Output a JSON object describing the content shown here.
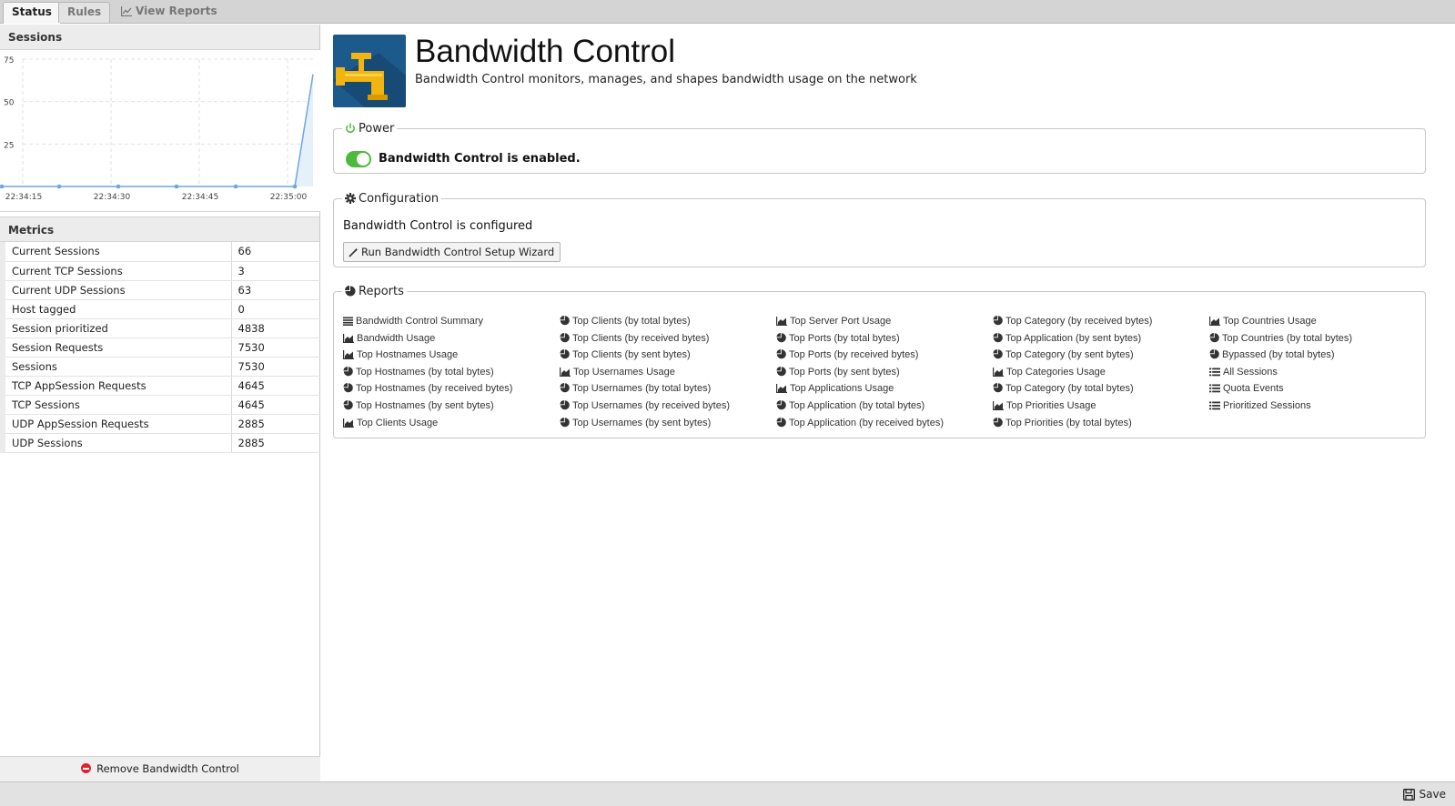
{
  "tabs": {
    "status": "Status",
    "rules": "Rules",
    "view_reports": "View Reports"
  },
  "sessions_panel": {
    "title": "Sessions"
  },
  "chart_data": {
    "type": "line",
    "title": "",
    "y_ticks": [
      "75",
      "50",
      "25"
    ],
    "x_ticks": [
      "22:34:15",
      "22:34:30",
      "22:34:45",
      "22:35:00"
    ],
    "ylim": [
      0,
      75
    ],
    "grid": true,
    "series": [
      {
        "values": [
          0,
          0,
          0,
          0,
          0,
          0,
          66
        ],
        "color": "#6ea6e0"
      }
    ]
  },
  "metrics_panel": {
    "title": "Metrics",
    "rows": [
      {
        "name": "Current Sessions",
        "value": "66"
      },
      {
        "name": "Current TCP Sessions",
        "value": "3"
      },
      {
        "name": "Current UDP Sessions",
        "value": "63"
      },
      {
        "name": "Host tagged",
        "value": "0"
      },
      {
        "name": "Session prioritized",
        "value": "4838"
      },
      {
        "name": "Session Requests",
        "value": "7530"
      },
      {
        "name": "Sessions",
        "value": "7530"
      },
      {
        "name": "TCP AppSession Requests",
        "value": "4645"
      },
      {
        "name": "TCP Sessions",
        "value": "4645"
      },
      {
        "name": "UDP AppSession Requests",
        "value": "2885"
      },
      {
        "name": "UDP Sessions",
        "value": "2885"
      }
    ],
    "remove_label": "Remove Bandwidth Control"
  },
  "app": {
    "title": "Bandwidth Control",
    "description": "Bandwidth Control monitors, manages, and shapes bandwidth usage on the network",
    "icon": "faucet-icon"
  },
  "power": {
    "legend": "Power",
    "status_text": "Bandwidth Control is enabled.",
    "enabled": true,
    "accent": "#4cbb3c"
  },
  "configuration": {
    "legend": "Configuration",
    "status_text": "Bandwidth Control is configured",
    "wizard_button": "Run Bandwidth Control Setup Wizard"
  },
  "reports": {
    "legend": "Reports",
    "columns": [
      [
        {
          "icon": "list",
          "label": "Bandwidth Control Summary"
        },
        {
          "icon": "area",
          "label": "Bandwidth Usage"
        },
        {
          "icon": "area",
          "label": "Top Hostnames Usage"
        },
        {
          "icon": "pie",
          "label": "Top Hostnames (by total bytes)"
        },
        {
          "icon": "pie",
          "label": "Top Hostnames (by received bytes)"
        },
        {
          "icon": "pie",
          "label": "Top Hostnames (by sent bytes)"
        },
        {
          "icon": "area",
          "label": "Top Clients Usage"
        }
      ],
      [
        {
          "icon": "pie",
          "label": "Top Clients (by total bytes)"
        },
        {
          "icon": "pie",
          "label": "Top Clients (by received bytes)"
        },
        {
          "icon": "pie",
          "label": "Top Clients (by sent bytes)"
        },
        {
          "icon": "area",
          "label": "Top Usernames Usage"
        },
        {
          "icon": "pie",
          "label": "Top Usernames (by total bytes)"
        },
        {
          "icon": "pie",
          "label": "Top Usernames (by received bytes)"
        },
        {
          "icon": "pie",
          "label": "Top Usernames (by sent bytes)"
        }
      ],
      [
        {
          "icon": "area",
          "label": "Top Server Port Usage"
        },
        {
          "icon": "pie",
          "label": "Top Ports (by total bytes)"
        },
        {
          "icon": "pie",
          "label": "Top Ports (by received bytes)"
        },
        {
          "icon": "pie",
          "label": "Top Ports (by sent bytes)"
        },
        {
          "icon": "area",
          "label": "Top Applications Usage"
        },
        {
          "icon": "pie",
          "label": "Top Application (by total bytes)"
        },
        {
          "icon": "pie",
          "label": "Top Application (by received bytes)"
        }
      ],
      [
        {
          "icon": "pie",
          "label": "Top Category (by received bytes)"
        },
        {
          "icon": "pie",
          "label": "Top Application (by sent bytes)"
        },
        {
          "icon": "pie",
          "label": "Top Category (by sent bytes)"
        },
        {
          "icon": "area",
          "label": "Top Categories Usage"
        },
        {
          "icon": "pie",
          "label": "Top Category (by total bytes)"
        },
        {
          "icon": "area",
          "label": "Top Priorities Usage"
        },
        {
          "icon": "pie",
          "label": "Top Priorities (by total bytes)"
        }
      ],
      [
        {
          "icon": "area",
          "label": "Top Countries Usage"
        },
        {
          "icon": "pie",
          "label": "Top Countries (by total bytes)"
        },
        {
          "icon": "pie",
          "label": "Bypassed (by total bytes)"
        },
        {
          "icon": "table",
          "label": "All Sessions"
        },
        {
          "icon": "table",
          "label": "Quota Events"
        },
        {
          "icon": "table",
          "label": "Prioritized Sessions"
        }
      ]
    ]
  },
  "footer": {
    "save_label": "Save"
  }
}
